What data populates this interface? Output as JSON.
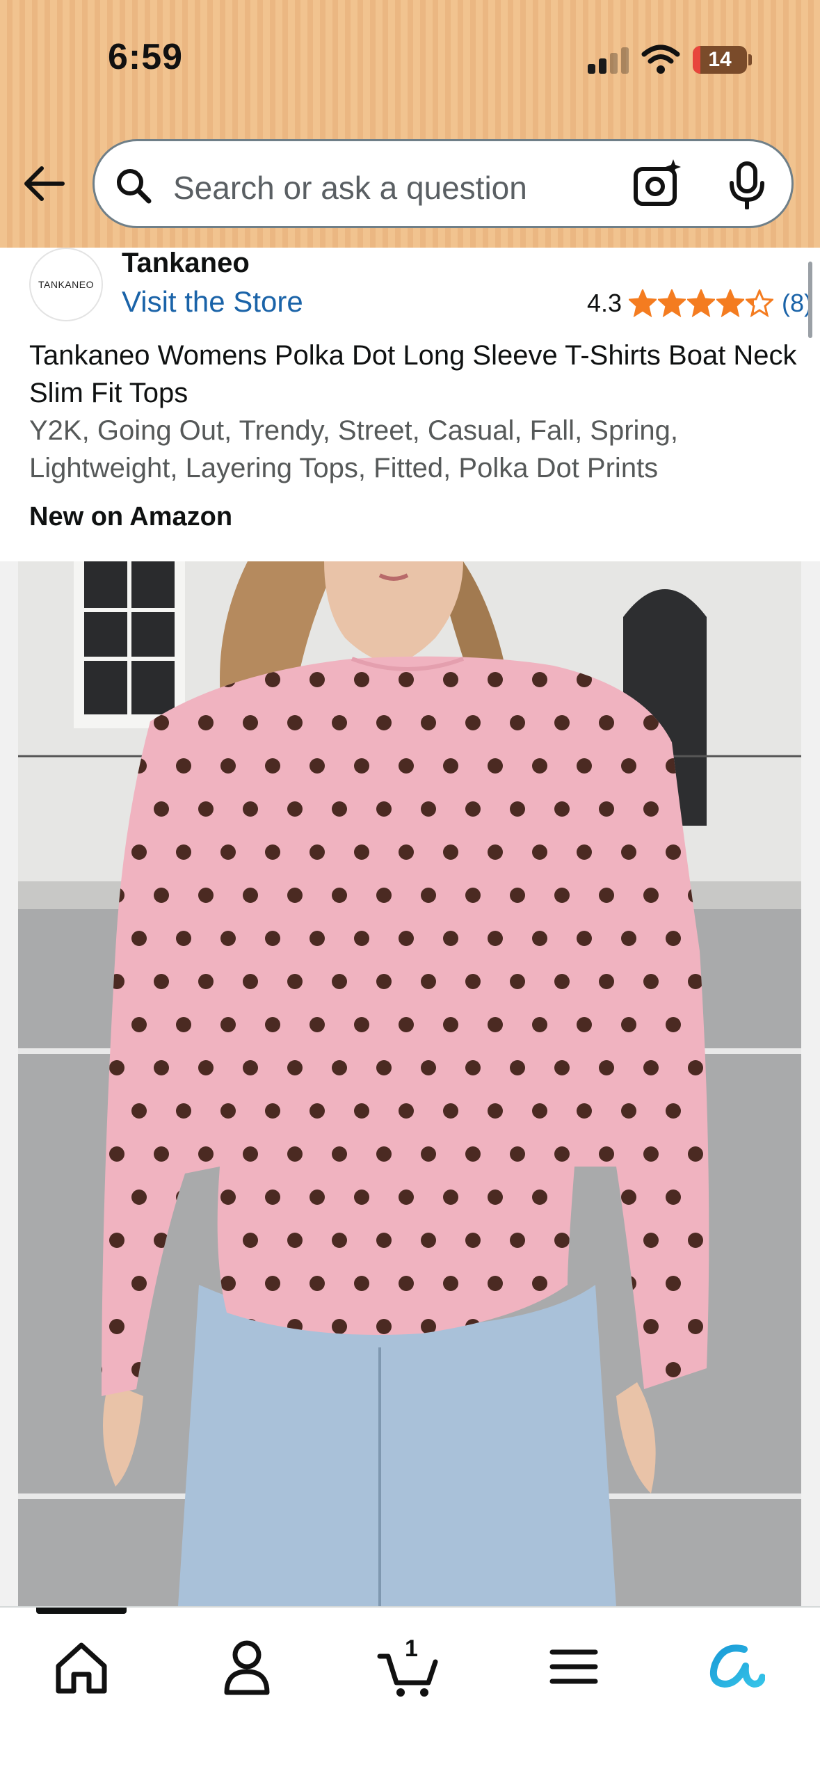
{
  "status_bar": {
    "time": "6:59",
    "battery_level": "14",
    "battery_fraction": 0.14
  },
  "search": {
    "placeholder": "Search or ask a question"
  },
  "icons": [
    "back-arrow-icon",
    "search-icon",
    "camera-icon",
    "mic-icon",
    "star-icon",
    "home-icon",
    "account-icon",
    "cart-icon",
    "menu-icon",
    "rufus-icon"
  ],
  "brand": {
    "logo_text": "TANKANEO",
    "name": "Tankaneo",
    "store_link": "Visit the Store"
  },
  "rating": {
    "value": "4.3",
    "count": "(8)",
    "stars_out_of_5": 4.3
  },
  "product": {
    "title": "Tankaneo Womens Polka Dot Long Sleeve T-Shirts Boat Neck Slim Fit Tops",
    "attributes": "Y2K, Going Out, Trendy, Street, Casual, Fall, Spring, Lightweight, Layering Tops, Fitted, Polka Dot Prints",
    "badge": "New on Amazon"
  },
  "bottom_nav": {
    "items": [
      "Home",
      "Account",
      "Cart",
      "Menu",
      "Rufus"
    ],
    "active": "Home",
    "cart_count": "1"
  },
  "colors": {
    "header_bg": "#f1c38f",
    "link": "#1a63a8",
    "star": "#f47c20",
    "shirt_pink": "#f0b3c0",
    "dot_brown": "#4b2a22"
  }
}
